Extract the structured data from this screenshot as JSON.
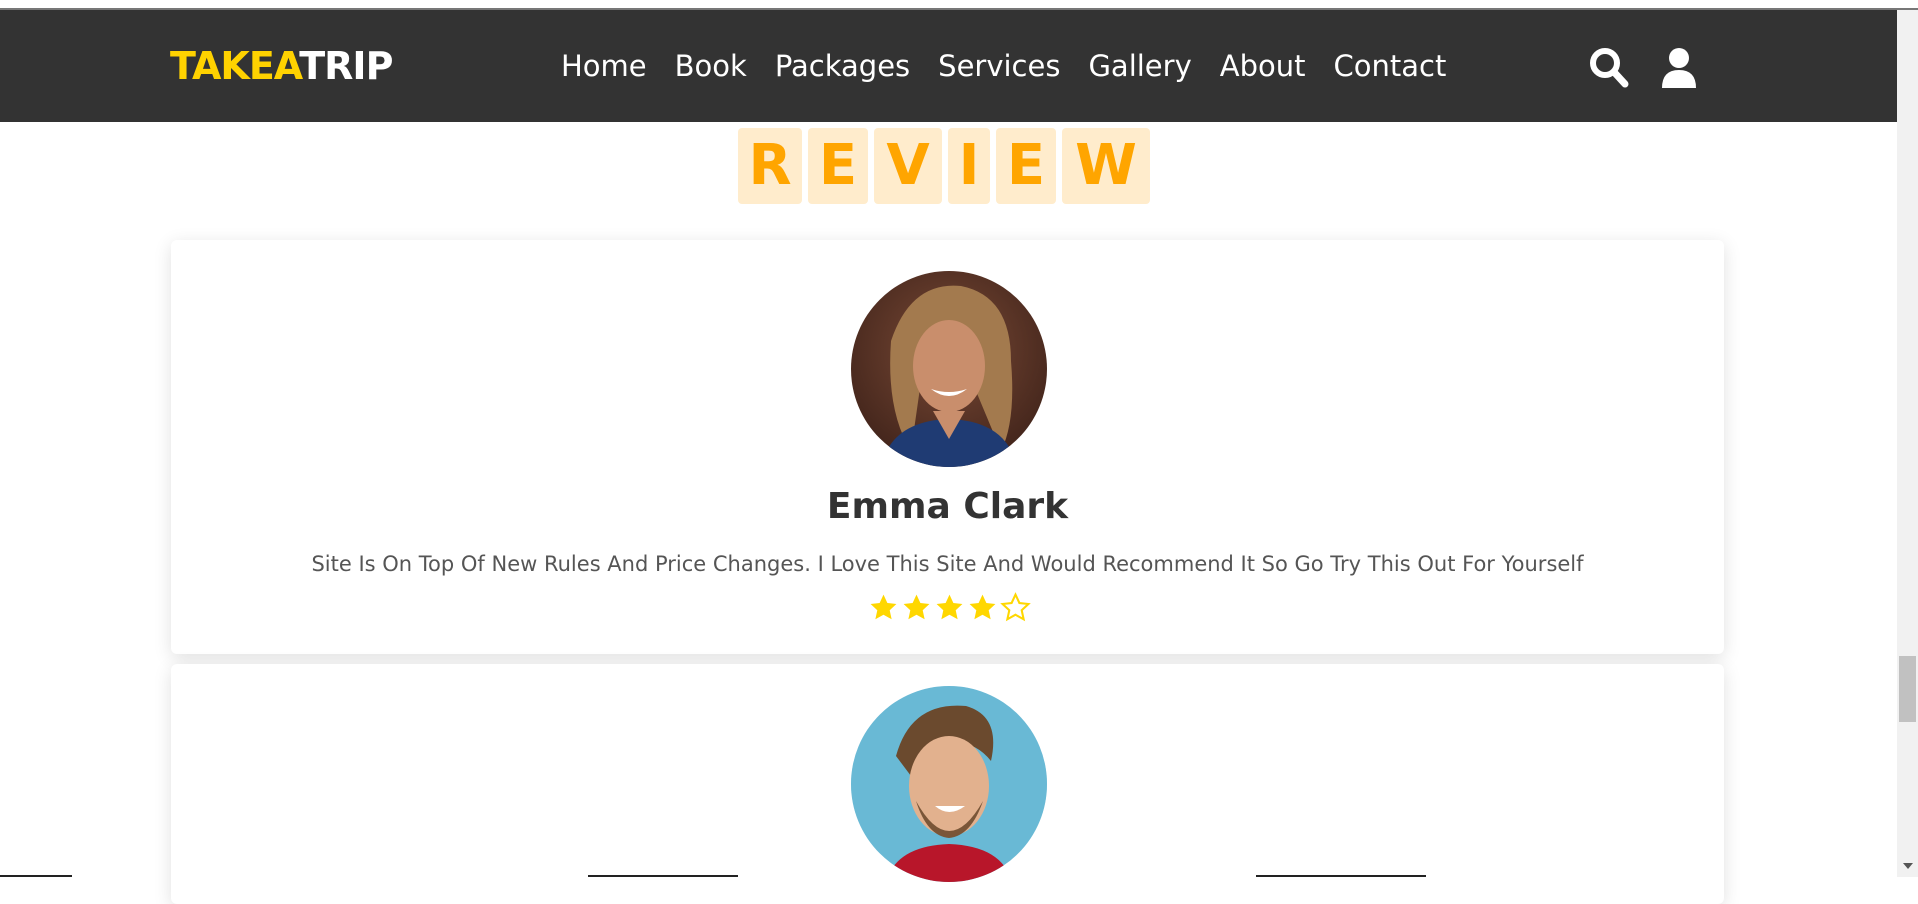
{
  "brand": {
    "part1": "TAKEA",
    "part2": "TRIP"
  },
  "nav": [
    "Home",
    "Book",
    "Packages",
    "Services",
    "Gallery",
    "About",
    "Contact"
  ],
  "header_icons": [
    "search-icon",
    "user-icon"
  ],
  "heading_letters": [
    "R",
    "E",
    "V",
    "I",
    "E",
    "W"
  ],
  "reviews": [
    {
      "name": "Emma Clark",
      "text": "Site Is On Top Of New Rules And Price Changes. I Love This Site And Would Recommend It So Go Try This Out For Yourself",
      "rating": 4,
      "max_rating": 5
    }
  ],
  "colors": {
    "header_bg": "#333333",
    "brand_accent": "#ffd200",
    "heading_letter": "#ffa500",
    "heading_tile": "#ffeccc",
    "star": "#ffd700"
  }
}
